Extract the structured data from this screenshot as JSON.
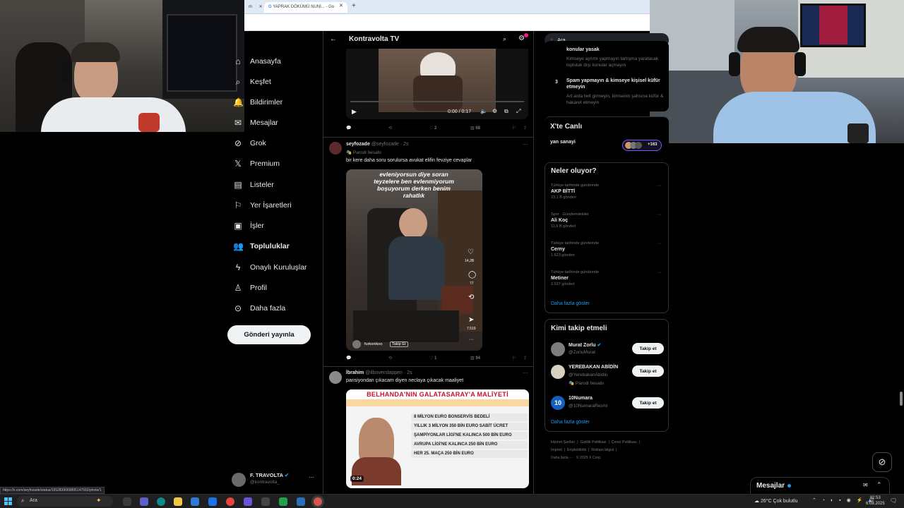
{
  "browser": {
    "tabs": [
      {
        "label": "m"
      },
      {
        "label": "YAPRAK DÖKÜMÜ NUNİ... - Go"
      }
    ],
    "status_url": "https://x.com/seyfozade/status/1952839069895147592/photo/1"
  },
  "sidebar": {
    "items": [
      {
        "label": "Anasayfa",
        "icon": "home-icon"
      },
      {
        "label": "Keşfet",
        "icon": "search-icon"
      },
      {
        "label": "Bildirimler",
        "icon": "bell-icon"
      },
      {
        "label": "Mesajlar",
        "icon": "mail-icon"
      },
      {
        "label": "Grok",
        "icon": "grok-icon"
      },
      {
        "label": "Premium",
        "icon": "x-logo-icon"
      },
      {
        "label": "Listeler",
        "icon": "list-icon"
      },
      {
        "label": "Yer İşaretleri",
        "icon": "bookmark-icon"
      },
      {
        "label": "İşler",
        "icon": "briefcase-icon"
      },
      {
        "label": "Topluluklar",
        "icon": "people-icon"
      },
      {
        "label": "Onaylı Kuruluşlar",
        "icon": "lightning-icon"
      },
      {
        "label": "Profil",
        "icon": "person-icon"
      },
      {
        "label": "Daha fazla",
        "icon": "more-circle-icon"
      }
    ],
    "post_button": "Gönderi yayınla",
    "account": {
      "name": "F. TRAVOLTA",
      "handle": "@kontravolta_"
    }
  },
  "header": {
    "title": "Kontravolta TV"
  },
  "video1": {
    "time": "0:00 / 0:17",
    "actions": {
      "likes": "2",
      "views": "68"
    }
  },
  "post1": {
    "name": "seyfozade",
    "handle": "@seyfozade · 2s",
    "badge": "Parodi hesabı",
    "text": "bir kere daha soru sorulursa avukat elifin fevziye cevaplar",
    "overlay_text": "evleniyorsun diye soran teyzelere ben evlenmiyorum boşuyorum derken benim rahatlık",
    "side_counts": {
      "likes": "14,2B",
      "comments": "77",
      "shares": "7.519"
    },
    "tiktok_user": "furkonikoo",
    "tiktok_follow": "Takip Et",
    "actions": {
      "likes": "1",
      "views": "94"
    }
  },
  "post2": {
    "name": "İbrahim",
    "handle": "@ilboverstappen · 2s",
    "text": "pansiyondan çıkacam diyen neclaya çıkacak maaliyet",
    "media_title": "BELHANDA'NIN GALATASARAY'A MALİYETİ",
    "media_lines": [
      "8 MİLYON EURO BONSERVİS BEDELİ",
      "YILLIK 3 MİLYON 350 BİN EURO SABİT ÜCRET",
      "ŞAMPİYONLAR LİGİ'NE KALINCA 500 BİN EURO",
      "AVRUPA LİGİ'NE KALINCA 250 BİN EURO",
      "HER 25. MAÇA 250 BİN EURO"
    ],
    "duration": "0:24"
  },
  "right": {
    "search_placeholder": "Ara",
    "rules": {
      "item2_tail": "konular yasak",
      "item2_desc": "Kimseye ayrımı yapmayın tartışma yaratacak topluluk dışı konular açmayın",
      "item3_num": "3",
      "item3_title": "Spam yapmayın & kimseye kişisel küfür etmeyin",
      "item3_desc": "Art arda twit girmeyin, kimsenin şahsına küfür & hakaret etmeyin"
    },
    "live": {
      "title": "X'te Canlı",
      "item": "yan sanayi",
      "count": "+163"
    },
    "trends": {
      "title": "Neler oluyor?",
      "items": [
        {
          "meta": "Türkiye tarihinde gündemde",
          "name": "AKP BİTTİ",
          "count": "23,1 B gönderi"
        },
        {
          "meta": "Spor · Gündemdekiler",
          "name": "Ali Koç",
          "count": "11,6 B gönderi"
        },
        {
          "meta": "Türkiye tarihinde gündemde",
          "name": "Cerny",
          "count": "1.623 gönderi"
        },
        {
          "meta": "Türkiye tarihinde gündemde",
          "name": "Metiner",
          "count": "2.537 gönderi"
        }
      ],
      "more": "Daha fazla göster"
    },
    "who_to_follow": {
      "title": "Kimi takip etmeli",
      "items": [
        {
          "name": "Murat Zorlu",
          "handle": "@ZorluMurat",
          "button": "Takip et"
        },
        {
          "name": "YEREBAKAN ABİDİN",
          "handle": "@YerebakanAbidin",
          "badge": "Parodi hesabı",
          "button": "Takip et"
        },
        {
          "name": "10Numara",
          "handle": "@10NumaraResmi",
          "button": "Takip et"
        }
      ],
      "more": "Daha fazla göster"
    },
    "footer": {
      "links": [
        "Hizmet Şartları",
        "Gizlilik Politikası",
        "Çerez Politikası",
        "Imprint",
        "Erişilebilirlik",
        "Reklam bilgisi",
        "Daha fazla ···",
        "© 2025 X Corp."
      ]
    }
  },
  "messages_bar": {
    "label": "Mesajlar"
  },
  "taskbar": {
    "search": "Ara",
    "weather": "26°C  Çok bulutlu",
    "time": "02:53",
    "date": "6.08.2025"
  },
  "colors": {
    "accent": "#1d9bf0",
    "background": "#000000",
    "text": "#e7e9ea",
    "muted": "#71767b"
  }
}
